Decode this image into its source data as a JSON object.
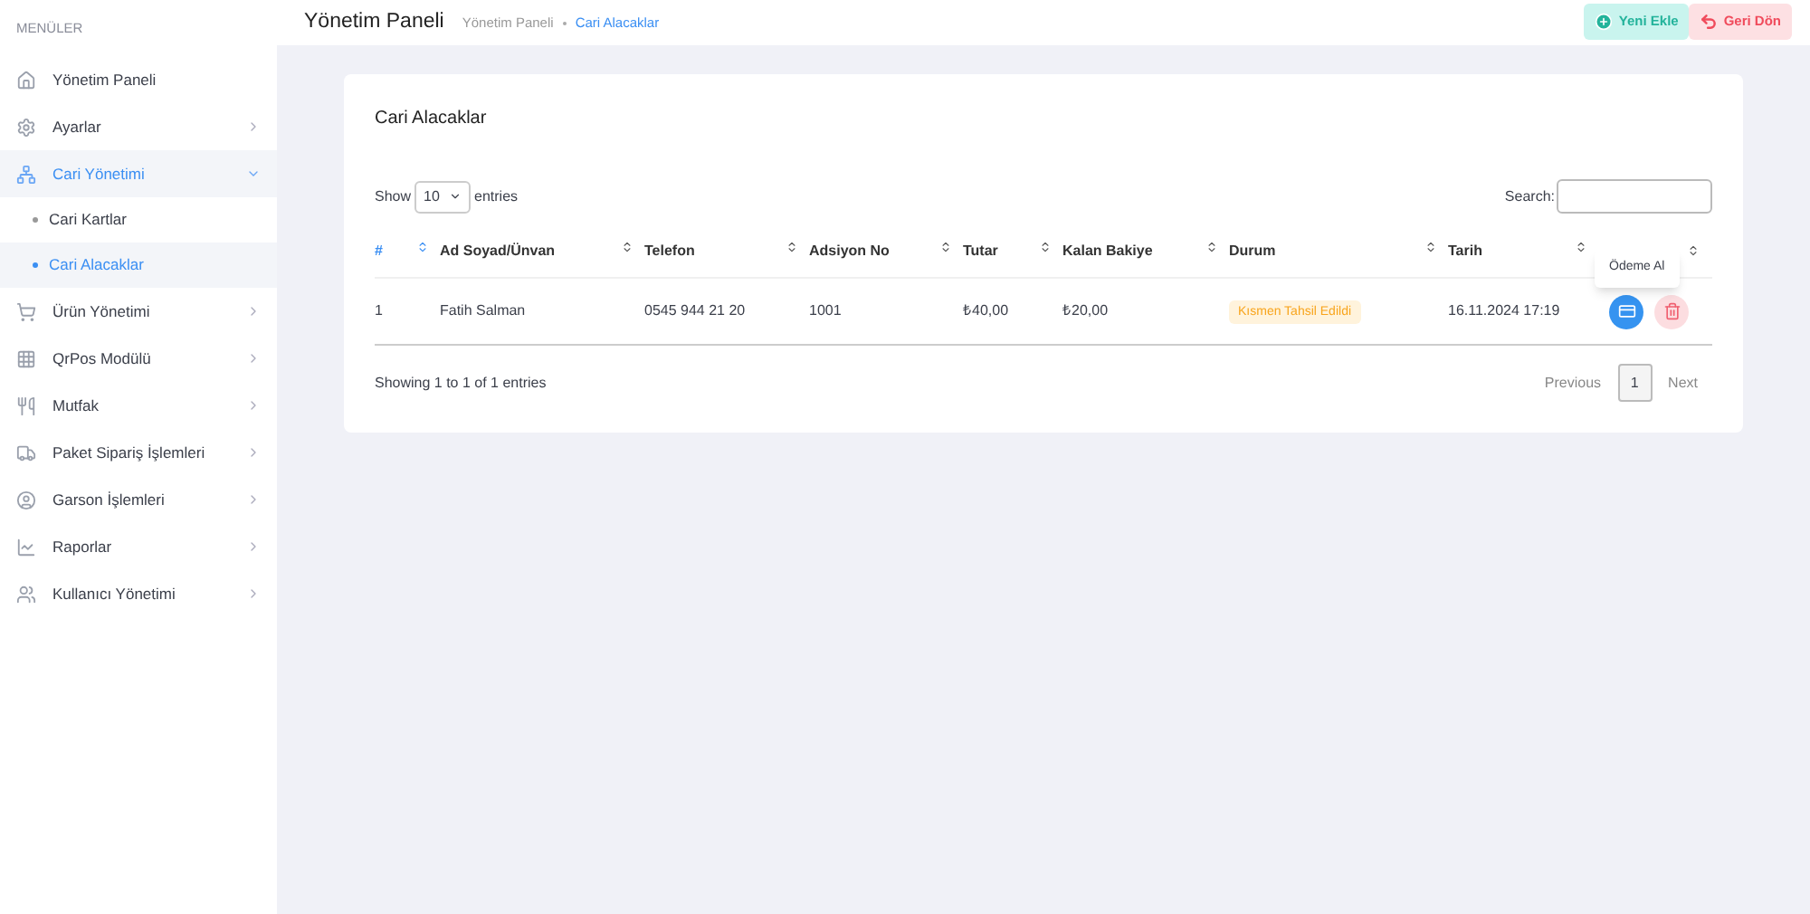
{
  "sidebar": {
    "heading": "MENÜLER",
    "items": [
      {
        "label": "Yönetim Paneli",
        "selected": false
      },
      {
        "label": "Ayarlar",
        "selected": false,
        "expanded": false
      },
      {
        "label": "Cari Yönetimi",
        "selected": true,
        "expanded": true,
        "children": [
          {
            "label": "Cari Kartlar",
            "selected": false
          },
          {
            "label": "Cari Alacaklar",
            "selected": true
          }
        ]
      },
      {
        "label": "Ürün Yönetimi",
        "selected": false,
        "expanded": false
      },
      {
        "label": "QrPos Modülü",
        "selected": false,
        "expanded": false
      },
      {
        "label": "Mutfak",
        "selected": false,
        "expanded": false
      },
      {
        "label": "Paket Sipariş İşlemleri",
        "selected": false,
        "expanded": false
      },
      {
        "label": "Garson İşlemleri",
        "selected": false,
        "expanded": false
      },
      {
        "label": "Raporlar",
        "selected": false,
        "expanded": false
      },
      {
        "label": "Kullanıcı Yönetimi",
        "selected": false,
        "expanded": false
      }
    ]
  },
  "header": {
    "title": "Yönetim Paneli",
    "breadcrumb": [
      "Yönetim Paneli",
      "Cari Alacaklar"
    ],
    "buttons": [
      {
        "label": "Yeni Ekle",
        "kind": "add"
      },
      {
        "label": "Geri Dön",
        "kind": "back"
      }
    ]
  },
  "card": {
    "title": "Cari Alacaklar",
    "show_label": "Show",
    "page_size": "10",
    "entries_label": "entries",
    "search_label": "Search:",
    "columns": [
      {
        "label": "#",
        "selected": true
      },
      {
        "label": "Ad Soyad/Ünvan",
        "selected": false
      },
      {
        "label": "Telefon",
        "selected": false
      },
      {
        "label": "Adsiyon No",
        "selected": false
      },
      {
        "label": "Tutar",
        "selected": false
      },
      {
        "label": "Kalan Bakiye",
        "selected": false
      },
      {
        "label": "Durum",
        "selected": false
      },
      {
        "label": "Tarih",
        "selected": false
      },
      {
        "selected": false
      }
    ],
    "rows": [
      {
        "cells": [
          "1",
          "Fatih Salman",
          "0545 944 21 20",
          "1001",
          "₺40,00",
          "₺20,00",
          "Kısmen Tahsil Edildi",
          "16.11.2024 17:19"
        ]
      }
    ],
    "tooltip": "Ödeme Al",
    "info": "Showing 1 to 1 of 1 entries",
    "pagination": {
      "previous": "Previous",
      "pages": [
        {
          "label": "1",
          "selected": true
        }
      ],
      "next": "Next"
    }
  }
}
